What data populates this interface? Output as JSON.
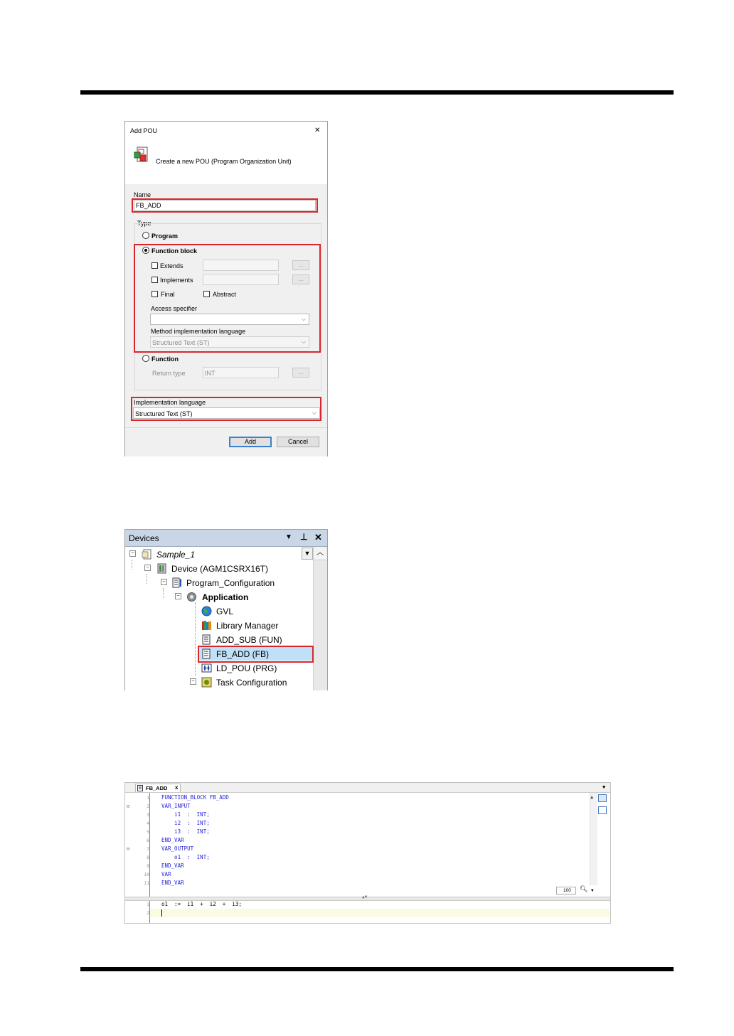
{
  "dialog": {
    "title": "Add POU",
    "close_symbol": "✕",
    "subtitle": "Create a new POU (Program Organization Unit)",
    "name_label": "Name",
    "name_value": "FB_ADD",
    "type_label": "Type",
    "program_label": "Program",
    "function_block_label": "Function block",
    "extends_label": "Extends",
    "implements_label": "Implements",
    "final_label": "Final",
    "abstract_label": "Abstract",
    "access_label": "Access specifier",
    "method_lang_label": "Method implementation language",
    "method_lang_value": "Structured Text (ST)",
    "function_label": "Function",
    "return_type_label": "Return type",
    "return_type_value": "INT",
    "ellipsis": "...",
    "impl_lang_label": "Implementation language",
    "impl_lang_value": "Structured Text (ST)",
    "add_button": "Add",
    "cancel_button": "Cancel",
    "selected_type": "Function block"
  },
  "devices": {
    "title": "Devices",
    "items": [
      {
        "label": "Sample_1"
      },
      {
        "label": "Device (AGM1CSRX16T)"
      },
      {
        "label": "Program_Configuration"
      },
      {
        "label": "Application"
      },
      {
        "label": "GVL"
      },
      {
        "label": "Library Manager"
      },
      {
        "label": "ADD_SUB (FUN)"
      },
      {
        "label": "FB_ADD (FB)"
      },
      {
        "label": "LD_POU (PRG)"
      },
      {
        "label": "Task Configuration"
      }
    ]
  },
  "editor": {
    "tab_label": "FB_ADD",
    "tab_close": "x",
    "zoom": "100",
    "decl_lines": [
      {
        "n": "1",
        "text": "FUNCTION_BLOCK FB_ADD"
      },
      {
        "n": "2",
        "text": "VAR_INPUT"
      },
      {
        "n": "3",
        "text": "    i1  :  INT;"
      },
      {
        "n": "4",
        "text": "    i2  :  INT;"
      },
      {
        "n": "5",
        "text": "    i3  :  INT;"
      },
      {
        "n": "6",
        "text": "END_VAR"
      },
      {
        "n": "7",
        "text": "VAR_OUTPUT"
      },
      {
        "n": "8",
        "text": "    o1  :  INT;"
      },
      {
        "n": "9",
        "text": "END_VAR"
      },
      {
        "n": "10",
        "text": "VAR"
      },
      {
        "n": "11",
        "text": "END_VAR"
      }
    ],
    "impl_lines": [
      {
        "n": "1",
        "text": "o1  :=  i1  +  i2  +  i3;"
      },
      {
        "n": "2",
        "text": ""
      }
    ]
  }
}
